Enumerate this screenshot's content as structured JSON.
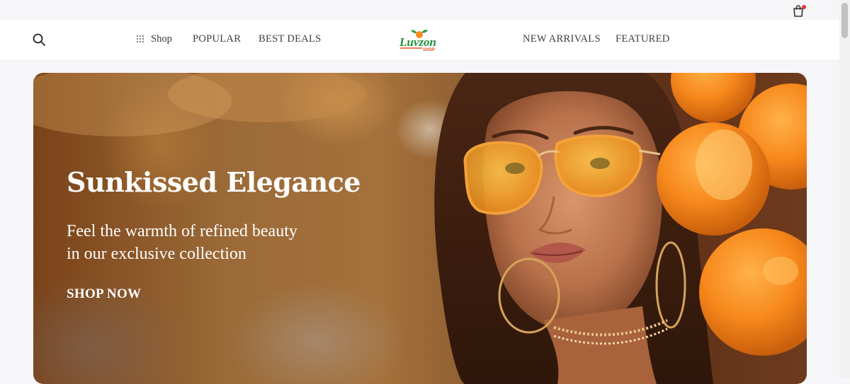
{
  "header": {
    "cart_icon": "shopping-bag-icon",
    "cart_badge_color": "#e53935",
    "search_icon": "search-icon"
  },
  "nav": {
    "left": [
      {
        "label": "Shop",
        "icon": "grid-icon"
      },
      {
        "label": "POPULAR"
      },
      {
        "label": "BEST DEALS"
      }
    ],
    "right": [
      {
        "label": "NEW ARRIVALS"
      },
      {
        "label": "FEATURED"
      }
    ]
  },
  "logo": {
    "brand": "Luvzon",
    "sub": "SHOP",
    "colors": {
      "primary": "#1e8f3a",
      "accent": "#e8501e",
      "sub": "#e8501e"
    }
  },
  "hero": {
    "title": "Sunkissed Elegance",
    "subtitle_line1": "Feel the warmth of refined beauty",
    "subtitle_line2": "in our exclusive collection",
    "cta": "SHOP NOW"
  }
}
